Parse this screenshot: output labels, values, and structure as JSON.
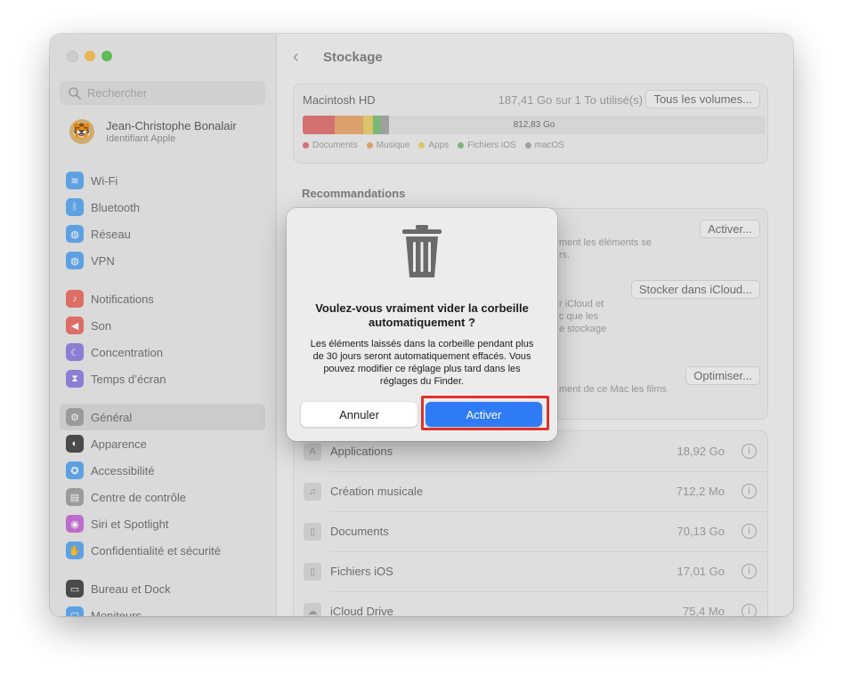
{
  "colors": {
    "accent": "#2f7bf5",
    "highlight": "#e0312b",
    "documents": "#e07070",
    "music": "#e9a66a",
    "apps": "#e8cd67",
    "ios_files": "#7cc07a",
    "macos": "#a5a5a5"
  },
  "sidebar": {
    "search_placeholder": "Rechercher",
    "account": {
      "name": "Jean-Christophe Bonalair",
      "subtitle": "Identifiant Apple",
      "avatar_icon": "tiger-icon"
    },
    "groups": [
      [
        {
          "label": "Wi-Fi",
          "icon": "wifi-icon",
          "color": "#5aa7f0"
        },
        {
          "label": "Bluetooth",
          "icon": "bluetooth-icon",
          "color": "#5aa7f0"
        },
        {
          "label": "Réseau",
          "icon": "globe-icon",
          "color": "#5aa7f0"
        },
        {
          "label": "VPN",
          "icon": "globe-icon",
          "color": "#5aa7f0"
        }
      ],
      [
        {
          "label": "Notifications",
          "icon": "bell-icon",
          "color": "#ea6d64"
        },
        {
          "label": "Son",
          "icon": "speaker-icon",
          "color": "#ea6d64"
        },
        {
          "label": "Concentration",
          "icon": "moon-icon",
          "color": "#8f7fe0"
        },
        {
          "label": "Temps d’écran",
          "icon": "hourglass-icon",
          "color": "#8f7fe0"
        }
      ],
      [
        {
          "label": "Général",
          "icon": "gear-icon",
          "color": "#a0a0a0",
          "selected": true
        },
        {
          "label": "Apparence",
          "icon": "appearance-icon",
          "color": "#444444"
        },
        {
          "label": "Accessibilité",
          "icon": "accessibility-icon",
          "color": "#5aa7f0"
        },
        {
          "label": "Centre de contrôle",
          "icon": "control-center-icon",
          "color": "#a0a0a0"
        },
        {
          "label": "Siri et Spotlight",
          "icon": "siri-icon",
          "color": "#c56bd6"
        },
        {
          "label": "Confidentialité et sécurité",
          "icon": "hand-icon",
          "color": "#5aa7f0"
        }
      ],
      [
        {
          "label": "Bureau et Dock",
          "icon": "dock-icon",
          "color": "#444444"
        },
        {
          "label": "Moniteurs",
          "icon": "display-icon",
          "color": "#5aa7f0"
        }
      ]
    ]
  },
  "main": {
    "title": "Stockage",
    "disk": {
      "name": "Macintosh HD",
      "usage": "187,41 Go sur 1 To utilisé(s)",
      "all_volumes_label": "Tous les volumes...",
      "free_label": "812,83 Go",
      "legend": [
        "Documents",
        "Musique",
        "Apps",
        "Fichiers iOS",
        "macOS"
      ]
    },
    "recommendations": {
      "title": "Recommandations",
      "items": [
        {
          "button": "Activer...",
          "text_lines": [
            "ment les éléments se",
            "rs."
          ]
        },
        {
          "button": "Stocker dans iCloud...",
          "text_lines": [
            "r iCloud et",
            "c que les",
            "e stockage"
          ]
        },
        {
          "button": "Optimiser...",
          "text_lines": [
            "ment de ce Mac les films"
          ]
        }
      ]
    },
    "categories": [
      {
        "name": "Applications",
        "size": "18,92 Go",
        "icon": "applications-icon"
      },
      {
        "name": "Création musicale",
        "size": "712,2 Mo",
        "icon": "music-creation-icon"
      },
      {
        "name": "Documents",
        "size": "70,13 Go",
        "icon": "document-icon"
      },
      {
        "name": "Fichiers iOS",
        "size": "17,01 Go",
        "icon": "phone-icon"
      },
      {
        "name": "iCloud Drive",
        "size": "75,4 Mo",
        "icon": "cloud-icon"
      }
    ]
  },
  "dialog": {
    "icon": "trash-icon",
    "title": "Voulez-vous vraiment vider la corbeille automatiquement ?",
    "body": "Les éléments laissés dans la corbeille pendant plus de 30 jours seront automatiquement effacés. Vous pouvez modifier ce réglage plus tard dans les réglages du Finder.",
    "cancel_label": "Annuler",
    "confirm_label": "Activer"
  }
}
